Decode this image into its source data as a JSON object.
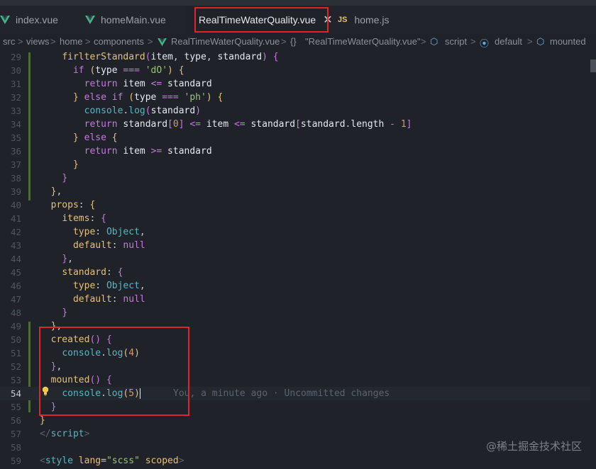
{
  "tabs": [
    {
      "label": "index.vue",
      "icon": "vue-icon"
    },
    {
      "label": "homeMain.vue",
      "icon": "vue-icon"
    },
    {
      "label": "RealTimeWaterQuality.vue",
      "icon": "vue-icon",
      "active": true
    },
    {
      "label": "home.js",
      "icon": "js-icon"
    }
  ],
  "js_badge": "JS",
  "close_glyph": "✕",
  "breadcrumb": {
    "path": [
      "src",
      "views",
      "home",
      "components"
    ],
    "file": "RealTimeWaterQuality.vue",
    "braces": "{}",
    "component": "\"RealTimeWaterQuality.vue\"",
    "script": "script",
    "default": "default",
    "mounted": "mounted",
    "sep": ">"
  },
  "editor": {
    "line_numbers": [
      "29",
      "30",
      "31",
      "32",
      "33",
      "34",
      "35",
      "36",
      "37",
      "38",
      "39",
      "40",
      "41",
      "42",
      "43",
      "44",
      "45",
      "46",
      "47",
      "48",
      "49",
      "50",
      "51",
      "52",
      "53",
      "54",
      "55",
      "56",
      "57",
      "58",
      "59"
    ],
    "current_line": "54",
    "blame": "You, a minute ago · Uncommitted changes"
  },
  "watermark": "@稀土掘金技术社区",
  "colors": {
    "highlight": "#e0242a",
    "background": "#1f2329",
    "vue_green": "#41b883"
  }
}
